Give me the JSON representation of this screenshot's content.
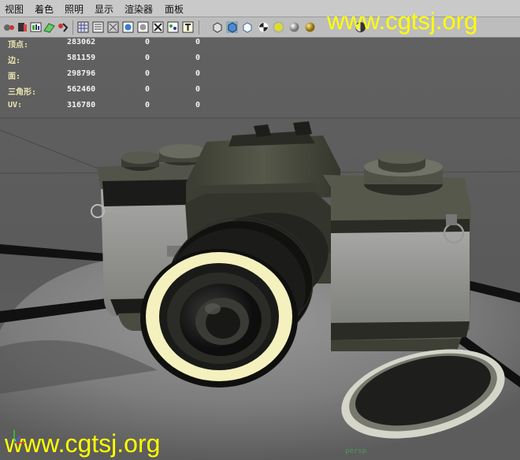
{
  "menu": {
    "items": [
      "视图",
      "着色",
      "照明",
      "显示",
      "渲染器",
      "面板"
    ]
  },
  "toolbar": {
    "icons": [
      "camera-attributes-icon",
      "bookmark-icon",
      "image-plane-icon",
      "grid-icon",
      "film-gate-icon",
      "wireframe-icon",
      "smooth-shade-icon",
      "shade-selected-icon",
      "xray-icon",
      "isolate-icon",
      "texture-icon",
      "display-lights-icon",
      "bounding-box-icon",
      "shaded-icon",
      "cube-wire-icon",
      "checker-icon",
      "default-light-icon",
      "sphere-icon",
      "all-lights-icon",
      "shadow-icon"
    ]
  },
  "hud": {
    "rows": [
      {
        "label": "顶点:",
        "v1": "283062",
        "v2": "0",
        "v3": "0"
      },
      {
        "label": "边:",
        "v1": "581159",
        "v2": "0",
        "v3": "0"
      },
      {
        "label": "面:",
        "v1": "298796",
        "v2": "0",
        "v3": "0"
      },
      {
        "label": "三角形:",
        "v1": "562460",
        "v2": "0",
        "v3": "0"
      },
      {
        "label": "UV:",
        "v1": "316780",
        "v2": "0",
        "v3": "0"
      }
    ]
  },
  "watermark": {
    "top": "www.cgtsj.org",
    "bottom": "www.cgtsj.org"
  },
  "viewport": {
    "camera_label": "persp",
    "colors": {
      "background": "#5c5c5c",
      "camera_body": "#3e4034",
      "lens_ring": "#f4f1bf",
      "hud_label": "#e9e6b0",
      "watermark": "#ffff00"
    }
  }
}
